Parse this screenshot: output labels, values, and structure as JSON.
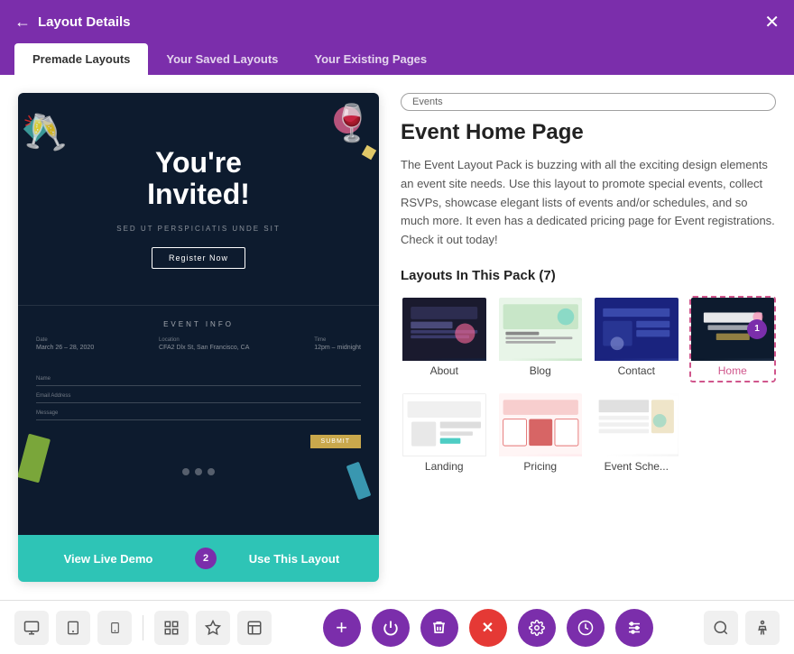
{
  "modal": {
    "title": "Layout Details",
    "back_icon": "←",
    "close_icon": "✕"
  },
  "tabs": [
    {
      "id": "premade",
      "label": "Premade Layouts",
      "active": true
    },
    {
      "id": "saved",
      "label": "Your Saved Layouts",
      "active": false
    },
    {
      "id": "existing",
      "label": "Your Existing Pages",
      "active": false
    }
  ],
  "preview": {
    "hero_title": "You're\nInvited!",
    "hero_sub": "SED UT PERSPICIATIS UNDE SIT",
    "hero_btn": "Register Now",
    "event_info_label": "EVENT INFO",
    "details": [
      {
        "label": "Date",
        "value": "March 26 – 28, 2020"
      },
      {
        "label": "Location",
        "value": "CFA2 Dlx St, San Francisco, CA"
      },
      {
        "label": "Time",
        "value": "12pm – midnight"
      }
    ],
    "form_fields": [
      "Name",
      "Email Address",
      "Message"
    ],
    "submit_label": "SUBMIT",
    "footer_left": "View Live Demo",
    "footer_right": "Use This Layout",
    "badge_2": "2"
  },
  "info": {
    "category": "Events",
    "title": "Event Home Page",
    "description": "The Event Layout Pack is buzzing with all the exciting design elements an event site needs. Use this layout to promote special events, collect RSVPs, showcase elegant lists of events and/or schedules, and so much more. It even has a dedicated pricing page for Event registrations. Check it out today!",
    "pack_label": "Layouts In This Pack (7)",
    "layouts": [
      {
        "id": "about",
        "label": "About",
        "selected": false,
        "theme": "about"
      },
      {
        "id": "blog",
        "label": "Blog",
        "selected": false,
        "theme": "blog"
      },
      {
        "id": "contact",
        "label": "Contact",
        "selected": false,
        "theme": "contact"
      },
      {
        "id": "home",
        "label": "Home",
        "selected": true,
        "theme": "home",
        "badge": "1"
      },
      {
        "id": "landing",
        "label": "Landing",
        "selected": false,
        "theme": "landing"
      },
      {
        "id": "pricing",
        "label": "Pricing",
        "selected": false,
        "theme": "pricing"
      },
      {
        "id": "eventsche",
        "label": "Event Sche...",
        "selected": false,
        "theme": "eventsche"
      }
    ]
  },
  "toolbar": {
    "left_buttons": [
      {
        "id": "monitor",
        "icon": "🖥",
        "label": "monitor-icon"
      },
      {
        "id": "tablet",
        "icon": "⬜",
        "label": "tablet-icon"
      },
      {
        "id": "mobile",
        "icon": "📱",
        "label": "mobile-icon"
      }
    ],
    "left_icons_2": [
      {
        "id": "grid1",
        "icon": "⊞",
        "label": "wireframe-icon"
      },
      {
        "id": "grid2",
        "icon": "✦",
        "label": "star-icon"
      },
      {
        "id": "grid3",
        "icon": "⊟",
        "label": "layout-icon"
      }
    ],
    "center_buttons": [
      {
        "id": "add",
        "icon": "+",
        "color": "purple",
        "label": "add-button"
      },
      {
        "id": "power",
        "icon": "⏻",
        "color": "purple",
        "label": "power-button"
      },
      {
        "id": "trash",
        "icon": "🗑",
        "color": "purple",
        "label": "trash-button"
      },
      {
        "id": "close",
        "icon": "✕",
        "color": "red",
        "label": "close-button"
      },
      {
        "id": "settings",
        "icon": "⚙",
        "color": "purple",
        "label": "settings-button"
      },
      {
        "id": "clock",
        "icon": "⏱",
        "color": "purple",
        "label": "history-button"
      },
      {
        "id": "sliders",
        "icon": "⇅",
        "color": "purple",
        "label": "sliders-button"
      }
    ],
    "right_buttons": [
      {
        "id": "search",
        "icon": "🔍",
        "label": "search-button"
      },
      {
        "id": "accessibility",
        "icon": "♿",
        "label": "accessibility-button"
      }
    ]
  },
  "colors": {
    "purple": "#7b2eab",
    "teal": "#2ec4b6",
    "red": "#e53935",
    "dark_navy": "#0d1b2e"
  }
}
